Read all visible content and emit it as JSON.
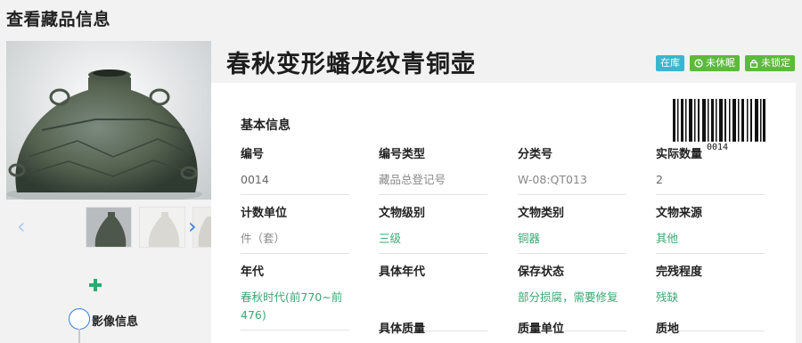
{
  "page": {
    "title": "查看藏品信息"
  },
  "gallery": {
    "prev_icon": "chevron-left-icon",
    "next_icon": "chevron-right-icon",
    "add_icon": "plus-icon"
  },
  "timeline": {
    "label": "影像信息"
  },
  "artifact": {
    "title": "春秋变形蟠龙纹青铜壶",
    "badges": [
      {
        "label": "在库",
        "color": "#3cb5cf"
      },
      {
        "label": "未休眠",
        "icon": "clock-icon",
        "color": "#5cba3b"
      },
      {
        "label": "未锁定",
        "icon": "lock-icon",
        "color": "#5cba3b"
      }
    ],
    "barcode_text": "0014"
  },
  "basic_info": {
    "section_title": "基本信息",
    "fields": [
      {
        "label": "编号",
        "value": "0014"
      },
      {
        "label": "编号类型",
        "value": "藏品总登记号"
      },
      {
        "label": "分类号",
        "value": "W-08:QT013"
      },
      {
        "label": "实际数量",
        "value": "2"
      },
      {
        "label": "计数单位",
        "value": "件（套）"
      },
      {
        "label": "文物级别",
        "value": "三级"
      },
      {
        "label": "文物类别",
        "value": "铜器"
      },
      {
        "label": "文物来源",
        "value": "其他"
      },
      {
        "label": "年代",
        "value": "春秋时代(前770~前476)"
      },
      {
        "label": "具体年代",
        "value": ""
      },
      {
        "label": "保存状态",
        "value": "部分损腐，需要修复"
      },
      {
        "label": "完残程度",
        "value": "残缺"
      },
      {
        "label": "具体质量",
        "value": ""
      },
      {
        "label": "质量单位",
        "value": ""
      },
      {
        "label": "质地",
        "value": ""
      }
    ]
  },
  "colors": {
    "accent_green": "#3aa873",
    "accent_blue": "#3a7fd8"
  }
}
